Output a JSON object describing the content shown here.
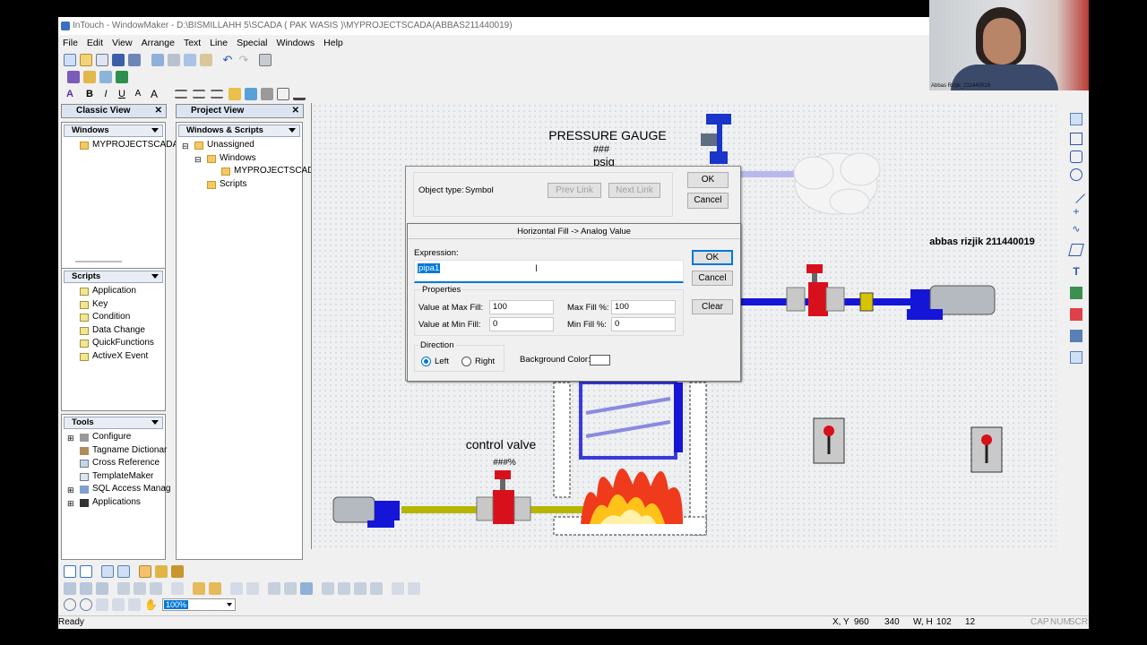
{
  "window": {
    "title": "InTouch - WindowMaker - D:\\BISMILLAHH 5\\SCADA ( PAK WASIS )\\MYPROJECTSCADA(ABBAS211440019)"
  },
  "menu": [
    "File",
    "Edit",
    "View",
    "Arrange",
    "Text",
    "Line",
    "Special",
    "Windows",
    "Help"
  ],
  "classic_view": {
    "title": "Classic View",
    "windows_label": "Windows",
    "windows_items": [
      "MYPROJECTSCADA"
    ],
    "scripts_label": "Scripts",
    "scripts_items": [
      "Application",
      "Key",
      "Condition",
      "Data Change",
      "QuickFunctions",
      "ActiveX Event"
    ],
    "tools_label": "Tools",
    "tools_items": [
      "Configure",
      "Tagname Dictionar",
      "Cross Reference",
      "TemplateMaker",
      "SQL Access Manag",
      "Applications"
    ]
  },
  "project_view": {
    "title": "Project View",
    "dropdown": "Windows & Scripts",
    "tree": [
      {
        "label": "Unassigned",
        "level": 0
      },
      {
        "label": "Windows",
        "level": 1
      },
      {
        "label": "MYPROJECTSCAD",
        "level": 2
      },
      {
        "label": "Scripts",
        "level": 1
      }
    ]
  },
  "canvas": {
    "pressure_title": "PRESSURE GAUGE",
    "pressure_value": "###",
    "pressure_unit": "psig",
    "author": "abbas rizjik 211440019",
    "control_valve": "control valve",
    "control_value": "###%"
  },
  "link_dialog": {
    "object_type_label": "Object type:",
    "object_type_value": "Symbol",
    "prev_link": "Prev Link",
    "next_link": "Next Link",
    "ok": "OK",
    "cancel": "Cancel"
  },
  "fill_dialog": {
    "title": "Horizontal Fill -> Analog Value",
    "expression_label": "Expression:",
    "expression_value": "pipa1",
    "ok": "OK",
    "cancel": "Cancel",
    "clear": "Clear",
    "properties_label": "Properties",
    "value_max_label": "Value at Max Fill:",
    "value_max": "100",
    "max_fill_label": "Max Fill %:",
    "max_fill": "100",
    "value_min_label": "Value at Min Fill:",
    "value_min": "0",
    "min_fill_label": "Min Fill %:",
    "min_fill": "0",
    "direction_label": "Direction",
    "left": "Left",
    "right": "Right",
    "selected_direction": "Left",
    "bg_color_label": "Background Color:"
  },
  "zoom": "100%",
  "status": {
    "ready": "Ready",
    "xy_label": "X, Y",
    "x": "960",
    "y": "340",
    "wh_label": "W, H",
    "w": "102",
    "h": "12",
    "caps": "CAP",
    "num": "NUM",
    "scrl": "SCRL"
  },
  "webcam": {
    "caption": "Abbas Rizjik_211440019"
  },
  "colors": {
    "pipe_blue": "#1515d8",
    "pipe_yellow": "#b6b600",
    "valve_red": "#d8101c",
    "selection": "#0078d7"
  }
}
